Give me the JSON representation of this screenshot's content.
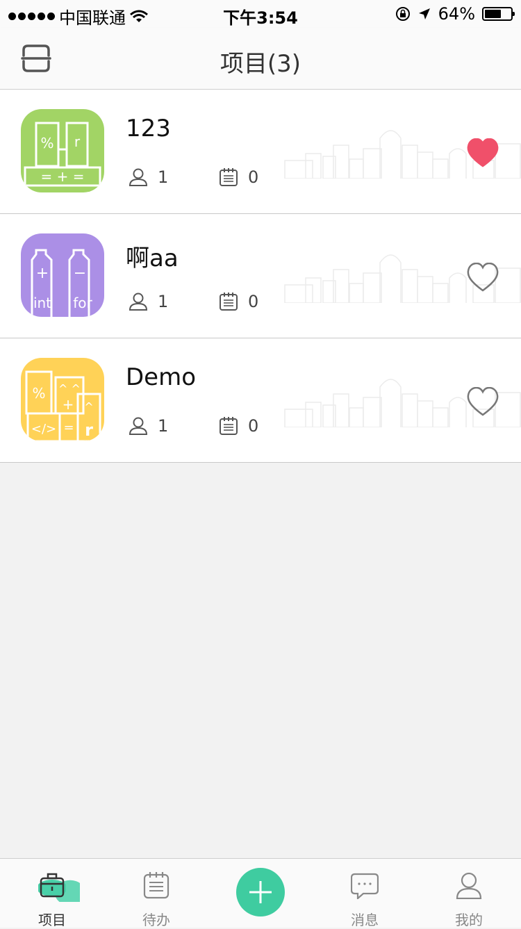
{
  "status_bar": {
    "carrier": "中国联通",
    "time": "下午3:54",
    "battery_percent": "64%",
    "battery_level": 0.64
  },
  "nav": {
    "title": "项目(3)",
    "left_icon": "scan-icon"
  },
  "projects": [
    {
      "name": "123",
      "members": "1",
      "tasks": "0",
      "favorited": true,
      "icon_color": "#a2d465",
      "icon_glyphs": [
        "%",
        "r",
        "= + ="
      ]
    },
    {
      "name": "啊aa",
      "members": "1",
      "tasks": "0",
      "favorited": false,
      "icon_color": "#ab8fe6",
      "icon_glyphs": [
        "+",
        "−",
        "int",
        "for"
      ]
    },
    {
      "name": "Demo",
      "members": "1",
      "tasks": "0",
      "favorited": false,
      "icon_color": "#ffd257",
      "icon_glyphs": [
        "%",
        "^ ^",
        "+",
        "^",
        "</>",
        "=",
        "r"
      ]
    }
  ],
  "tab_bar": {
    "tabs": [
      {
        "label": "项目",
        "icon": "project-box-icon",
        "active": true
      },
      {
        "label": "待办",
        "icon": "clipboard-icon",
        "active": false
      },
      {
        "label": "",
        "icon": "plus-icon",
        "active": false
      },
      {
        "label": "消息",
        "icon": "chat-bubble-icon",
        "active": false
      },
      {
        "label": "我的",
        "icon": "person-icon",
        "active": false
      }
    ]
  },
  "colors": {
    "accent": "#3fcca0",
    "favorite": "#f0506a",
    "background": "#f2f2f2"
  }
}
